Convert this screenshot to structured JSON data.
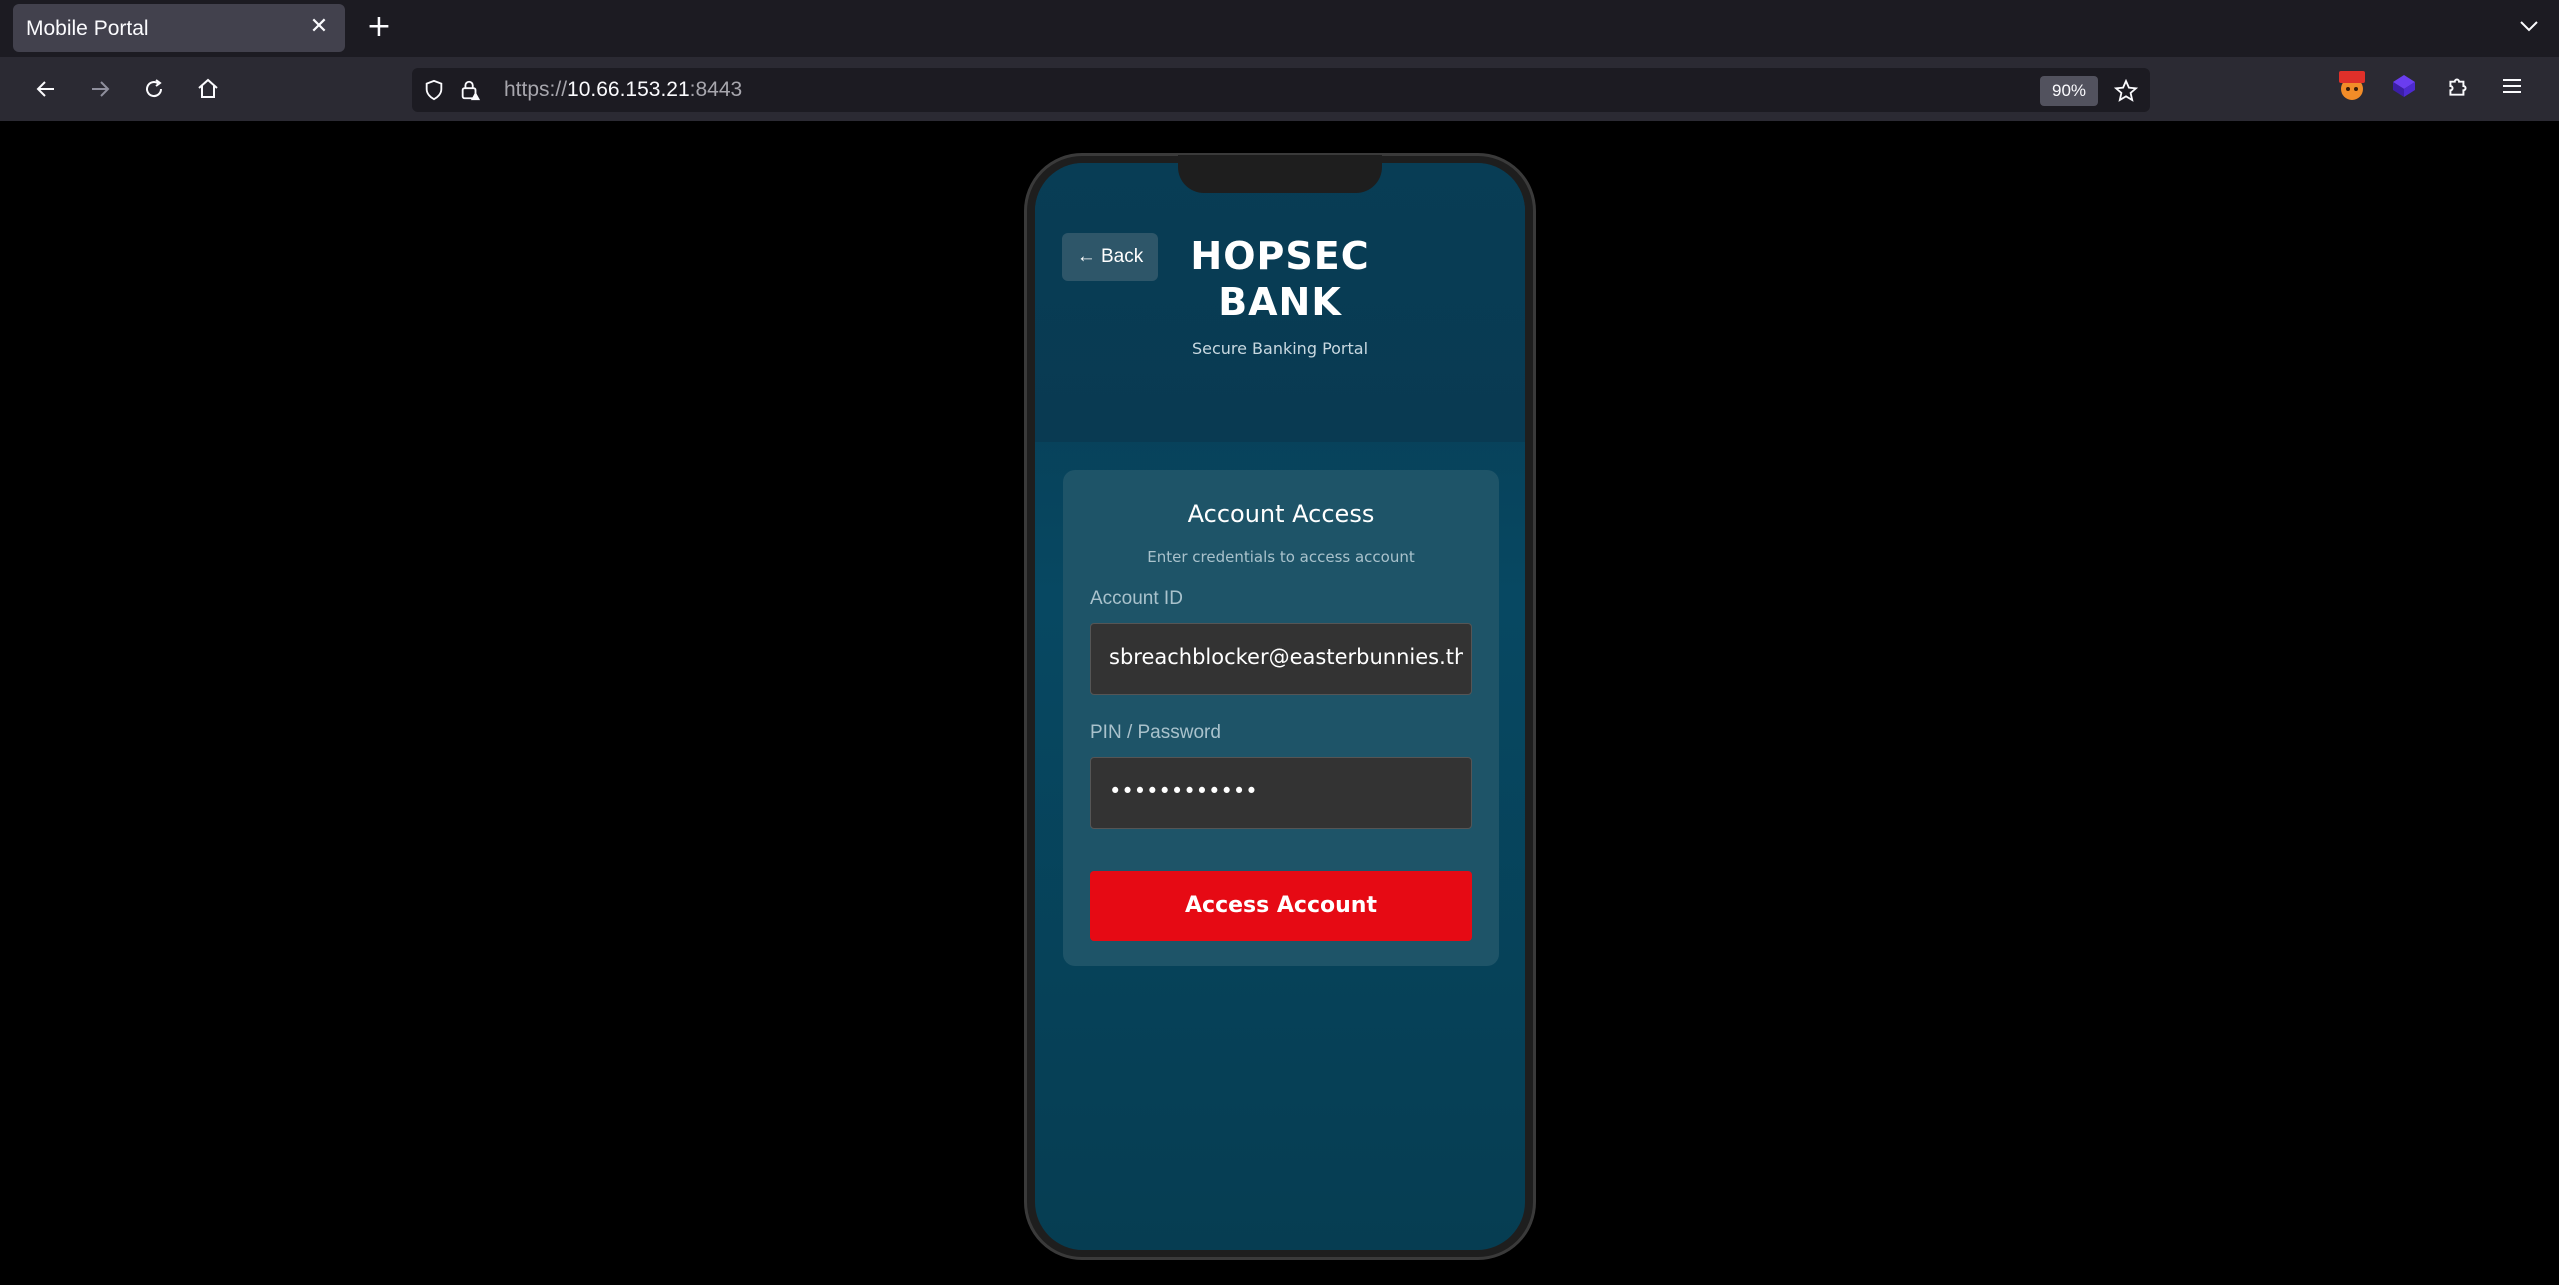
{
  "browser": {
    "tab_title": "Mobile Portal",
    "url_host": "10.66.153.21",
    "url_scheme": "https://",
    "url_port": ":8443",
    "zoom": "90%"
  },
  "app": {
    "back_label": "← Back",
    "bank_name_line1": "HOPSEC",
    "bank_name_line2": "BANK",
    "bank_subtitle": "Secure Banking Portal",
    "card_title": "Account Access",
    "card_subtitle": "Enter credentials to access account",
    "account_id_label": "Account ID",
    "account_id_value": "sbreachblocker@easterbunnies.thm",
    "pin_label": "PIN / Password",
    "pin_value": "••••••••••••",
    "submit_label": "Access Account"
  },
  "colors": {
    "accent": "#e60a14",
    "card_bg": "#1e5468",
    "screen_bg": "#074862"
  }
}
